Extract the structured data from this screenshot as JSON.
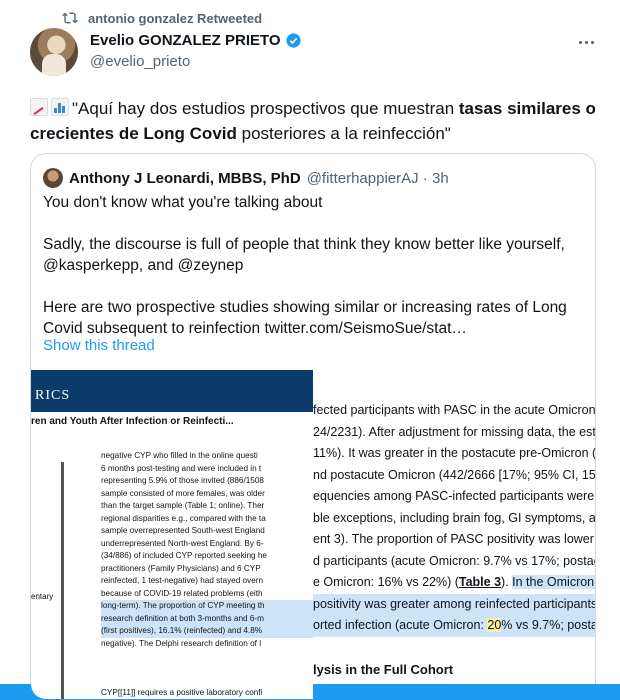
{
  "retweet": {
    "icon": "retweet-icon",
    "text": "antonio gonzalez Retweeted"
  },
  "tweet": {
    "author_name": "Evelio GONZALEZ PRIETO",
    "author_handle": "@evelio_prieto",
    "text_prefix": "\"Aquí hay dos estudios prospectivos que muestran ",
    "text_bold": "tasas similares o crecientes de Long Covid",
    "text_suffix": " posteriores a la reinfección\""
  },
  "quote": {
    "author_name": "Anthony J Leonardi, MBBS, PhD",
    "author_handle": "@fitterhappierAJ",
    "time": " · 3h",
    "para1": "You don't know what you're talking about",
    "para2": "Sadly, the discourse is full of people that think they know better like yourself, @kasperkepp, and @zeynep",
    "para3": "Here are two prospective studies showing similar or increasing rates of Long Covid subsequent to reinfection  twitter.com/SeismoSue/stat…",
    "show_thread": "Show this thread"
  },
  "paper": {
    "header": "RICS",
    "subtitle": "ren and Youth After Infection or Reinfecti...",
    "mentary": "entary",
    "left_lines": [
      "negative CYP who filled in the online questi",
      "6 months post-testing and were included in t",
      "representing 5.9% of those invited (886/1508",
      "sample consisted of more females, was older",
      "than the target sample (Table 1; online). Ther",
      "regional disparities e.g., compared with the ta",
      "sample overrepresented South-west England",
      "underrepresented North-west England. By 6-",
      "(34/886) of included CYP reported seeking he",
      "practitioners (Family Physicians) and 6 CYP",
      "reinfected, 1 test-negative) had stayed overn",
      "because of COVID-19 related problems (eith",
      "long-term). The proportion of CYP meeting th",
      "research definition at both 3-months and 6-m",
      "(first positives), 16.1% (reinfected) and 4.8%",
      "negative). The Delphi research definition of l"
    ],
    "left_foot": "CYP[[11]] requires a positive laboratory confi",
    "right_lines": [
      "fected participants with PASC in the acute Omicron sub",
      "24/2231). After adjustment for missing data, the esti",
      "11%). It was greater in the postacute pre-Omicron (13",
      "nd postacute Omicron (442/2666 [17%; 95% CI, 15%",
      "equencies among PASC-infected participants were si",
      "ble exceptions, including brain fog, GI symptoms, an",
      "ent 3). The proportion of PASC positivity was lower an",
      "d participants (acute Omicron: 9.7% vs 17%; postac",
      "e Omicron: 16% vs 22%) (",
      "Table 3",
      "). ",
      "In the Omicron co",
      " positivity was greater among reinfected participants",
      "orted infection (acute Omicron: ",
      "20",
      "% vs 9.7%; postac"
    ],
    "bottom_heading": "lysis in the Full Cohort"
  },
  "colors": {
    "accent": "#1d9bf0",
    "journal_header": "#0b3a6b",
    "highlight": "#cde3f7",
    "muted": "#536471"
  }
}
